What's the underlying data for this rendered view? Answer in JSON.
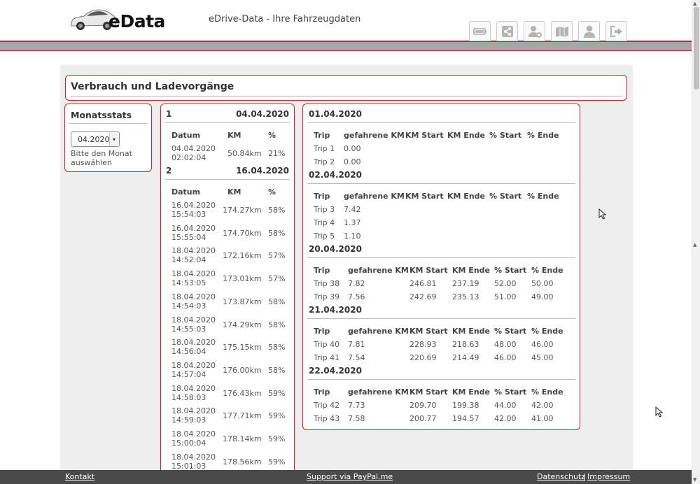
{
  "header": {
    "logo_text": "eData",
    "app_title": "eDrive-Data - Ihre Fahrzeugdaten"
  },
  "page": {
    "title": "Verbrauch und Ladevorgänge"
  },
  "monats": {
    "title": "Monatsstats",
    "selected": "04.2020",
    "hint": "Bitte den Monat auswählen"
  },
  "charges": [
    {
      "num": "1",
      "date": "04.04.2020",
      "headers": [
        "Datum",
        "KM",
        "%"
      ],
      "rows": [
        {
          "datum": "04.04.2020",
          "zeit": "02:02:04",
          "km": "50.84km",
          "pct": "21%"
        }
      ]
    },
    {
      "num": "2",
      "date": "16.04.2020",
      "headers": [
        "Datum",
        "KM",
        "%"
      ],
      "rows": [
        {
          "datum": "16.04.2020",
          "zeit": "15:54:03",
          "km": "174.27km",
          "pct": "58%"
        },
        {
          "datum": "16.04.2020",
          "zeit": "15:55:04",
          "km": "174.70km",
          "pct": "58%"
        },
        {
          "datum": "18.04.2020",
          "zeit": "14:52:04",
          "km": "172.16km",
          "pct": "57%"
        },
        {
          "datum": "18.04.2020",
          "zeit": "14:53:05",
          "km": "173.01km",
          "pct": "57%"
        },
        {
          "datum": "18.04.2020",
          "zeit": "14:54:03",
          "km": "173.87km",
          "pct": "58%"
        },
        {
          "datum": "18.04.2020",
          "zeit": "14:55:03",
          "km": "174.29km",
          "pct": "58%"
        },
        {
          "datum": "18.04.2020",
          "zeit": "14:56:04",
          "km": "175.15km",
          "pct": "58%"
        },
        {
          "datum": "18.04.2020",
          "zeit": "14:57:04",
          "km": "176.00km",
          "pct": "58%"
        },
        {
          "datum": "18.04.2020",
          "zeit": "14:58:03",
          "km": "176.43km",
          "pct": "59%"
        },
        {
          "datum": "18.04.2020",
          "zeit": "14:59:03",
          "km": "177.71km",
          "pct": "59%"
        },
        {
          "datum": "18.04.2020",
          "zeit": "15:00:04",
          "km": "178.14km",
          "pct": "59%"
        },
        {
          "datum": "18.04.2020",
          "zeit": "15:01:03",
          "km": "178.56km",
          "pct": "59%"
        }
      ]
    }
  ],
  "trip_headers": [
    "Trip",
    "gefahrene KM",
    "KM Start",
    "KM Ende",
    "% Start",
    "% Ende"
  ],
  "trip_days": [
    {
      "date": "01.04.2020",
      "trips": [
        {
          "name": "Trip 1",
          "km": "0.00",
          "km_start": "",
          "km_end": "",
          "pct_start": "",
          "pct_end": ""
        },
        {
          "name": "Trip 2",
          "km": "0.00",
          "km_start": "",
          "km_end": "",
          "pct_start": "",
          "pct_end": ""
        }
      ]
    },
    {
      "date": "02.04.2020",
      "trips": [
        {
          "name": "Trip 3",
          "km": "7.42",
          "km_start": "",
          "km_end": "",
          "pct_start": "",
          "pct_end": ""
        },
        {
          "name": "Trip 4",
          "km": "1.37",
          "km_start": "",
          "km_end": "",
          "pct_start": "",
          "pct_end": ""
        },
        {
          "name": "Trip 5",
          "km": "1.10",
          "km_start": "",
          "km_end": "",
          "pct_start": "",
          "pct_end": ""
        }
      ]
    },
    {
      "date": "20.04.2020",
      "trips": [
        {
          "name": "Trip 38",
          "km": "7.82",
          "km_start": "246.81",
          "km_end": "237.19",
          "pct_start": "52.00",
          "pct_end": "50.00"
        },
        {
          "name": "Trip 39",
          "km": "7.56",
          "km_start": "242.69",
          "km_end": "235.13",
          "pct_start": "51.00",
          "pct_end": "49.00"
        }
      ]
    },
    {
      "date": "21.04.2020",
      "trips": [
        {
          "name": "Trip 40",
          "km": "7.81",
          "km_start": "228.93",
          "km_end": "218.63",
          "pct_start": "48.00",
          "pct_end": "46.00"
        },
        {
          "name": "Trip 41",
          "km": "7.54",
          "km_start": "220.69",
          "km_end": "214.49",
          "pct_start": "46.00",
          "pct_end": "45.00"
        }
      ]
    },
    {
      "date": "22.04.2020",
      "trips": [
        {
          "name": "Trip 42",
          "km": "7.73",
          "km_start": "209.70",
          "km_end": "199.38",
          "pct_start": "44.00",
          "pct_end": "42.00"
        },
        {
          "name": "Trip 43",
          "km": "7.58",
          "km_start": "200.77",
          "km_end": "194.57",
          "pct_start": "42.00",
          "pct_end": "41.00"
        }
      ]
    }
  ],
  "footer": {
    "kontakt": "Kontakt",
    "support": "Support via PayPal.me",
    "datenschutz": "Datenschutz",
    "separator": "|",
    "impressum": "Impressum"
  },
  "nav_icons": [
    "battery-icon",
    "share-icon",
    "user-settings-icon",
    "map-icon",
    "user-icon",
    "logout-icon"
  ],
  "colors": {
    "accent": "#c9262c",
    "greybar": "#a6a6a6",
    "footer": "#4a4a4a"
  }
}
